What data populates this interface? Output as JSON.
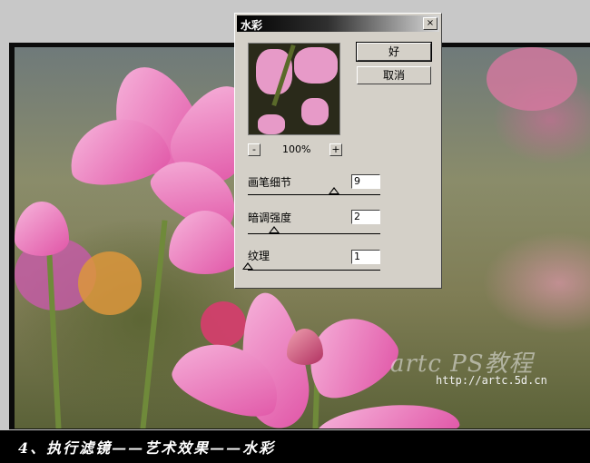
{
  "dialog": {
    "title": "水彩",
    "close": "×",
    "ok_label": "好",
    "cancel_label": "取消",
    "zoom_minus": "-",
    "zoom_plus": "+",
    "zoom_level": "100%",
    "params": [
      {
        "label": "画笔细节",
        "value": "9",
        "slider_fraction": 0.65
      },
      {
        "label": "暗调强度",
        "value": "2",
        "slider_fraction": 0.2
      },
      {
        "label": "纹理",
        "value": "1",
        "slider_fraction": 0.0
      }
    ]
  },
  "watermark": "artc PS教程",
  "url": "http://artc.5d.cn",
  "caption": "4、执行滤镜——艺术效果——水彩"
}
